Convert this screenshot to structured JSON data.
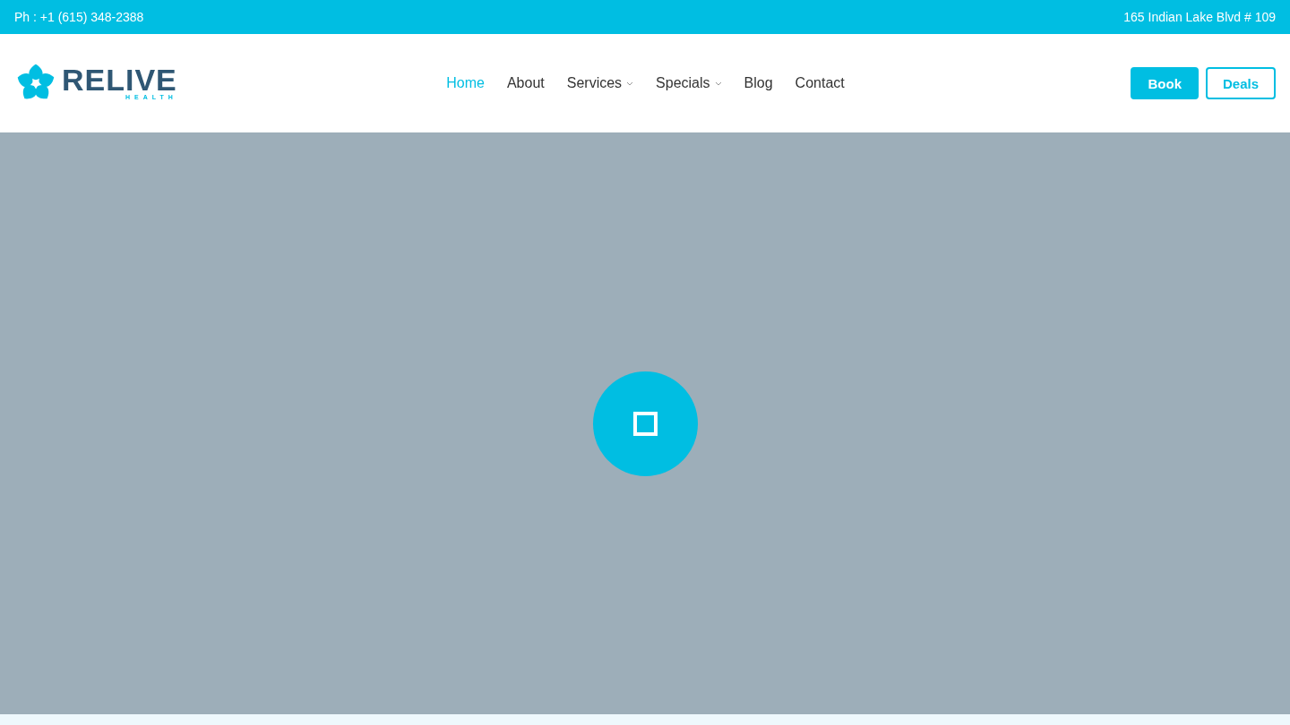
{
  "top_bar": {
    "phone": "Ph : +1 (615) 348-2388",
    "address": "165 Indian Lake Blvd # 109"
  },
  "logo": {
    "name": "RELIVE",
    "tagline": "HEALTH"
  },
  "nav": [
    {
      "label": "Home",
      "selected": true,
      "dropdown": false
    },
    {
      "label": "About",
      "selected": false,
      "dropdown": false
    },
    {
      "label": "Services",
      "selected": false,
      "dropdown": true
    },
    {
      "label": "Specials",
      "selected": false,
      "dropdown": true
    },
    {
      "label": "Blog",
      "selected": false,
      "dropdown": false
    },
    {
      "label": "Contact",
      "selected": false,
      "dropdown": false
    }
  ],
  "buttons": [
    {
      "label": "Book",
      "kind": "filled"
    },
    {
      "label": "Deals",
      "kind": "outline"
    }
  ]
}
